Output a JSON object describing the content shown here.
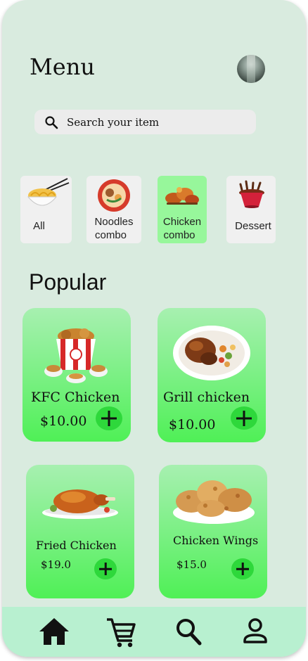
{
  "header": {
    "title": "Menu"
  },
  "search": {
    "placeholder": "Search your item"
  },
  "categories": [
    {
      "label": "All",
      "icon": "noodle-bowl-icon",
      "active": false
    },
    {
      "label": "Noodles combo",
      "line1": "Noodles",
      "line2": "combo",
      "icon": "noodle-soup-icon",
      "active": false
    },
    {
      "label": "Chicken combo",
      "line1": "Chicken",
      "line2": "combo",
      "icon": "chicken-pieces-icon",
      "active": true
    },
    {
      "label": "Dessert",
      "icon": "dessert-cup-icon",
      "active": false
    }
  ],
  "section": {
    "title": "Popular"
  },
  "items": [
    {
      "name": "KFC Chicken",
      "price": "$10.00",
      "image": "kfc-bucket-image"
    },
    {
      "name": "Grill chicken",
      "price": "$10.00",
      "image": "grill-chicken-plate-image"
    },
    {
      "name": "Fried Chicken",
      "price": "$19.0",
      "image": "roast-chicken-image"
    },
    {
      "name": "Chicken Wings",
      "price": "$15.0",
      "image": "chicken-wings-plate-image"
    }
  ],
  "nav": [
    {
      "icon": "home-icon"
    },
    {
      "icon": "cart-icon"
    },
    {
      "icon": "search-icon"
    },
    {
      "icon": "profile-icon"
    }
  ],
  "colors": {
    "background": "#d9ebdf",
    "accent": "#2ed83b",
    "card_gradient_top": "#a7f0b0",
    "card_gradient_bottom": "#4ff056",
    "navbar": "#b8f0d0",
    "active_category": "#97f79b"
  }
}
